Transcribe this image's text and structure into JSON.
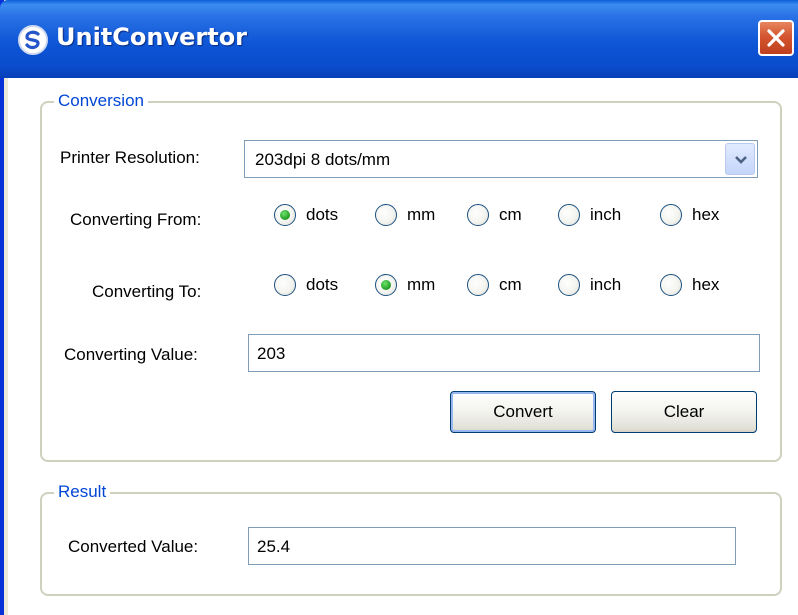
{
  "window": {
    "title": "UnitConvertor"
  },
  "conversion": {
    "group_label": "Conversion",
    "printer_resolution_label": "Printer Resolution:",
    "printer_resolution_value": "203dpi 8 dots/mm",
    "converting_from_label": "Converting From:",
    "converting_to_label": "Converting To:",
    "units": [
      "dots",
      "mm",
      "cm",
      "inch",
      "hex"
    ],
    "from_selected": "dots",
    "to_selected": "mm",
    "converting_value_label": "Converting Value:",
    "converting_value": "203",
    "convert_button": "Convert",
    "clear_button": "Clear"
  },
  "result": {
    "group_label": "Result",
    "converted_value_label": "Converted Value:",
    "converted_value": "25.4"
  },
  "icons": {
    "app": "app-logo-icon",
    "close": "close-icon",
    "dropdown": "chevron-down-icon"
  },
  "colors": {
    "titlebar": "#0a4ccc",
    "group_label": "#0046d5",
    "close_button": "#d4552f"
  }
}
